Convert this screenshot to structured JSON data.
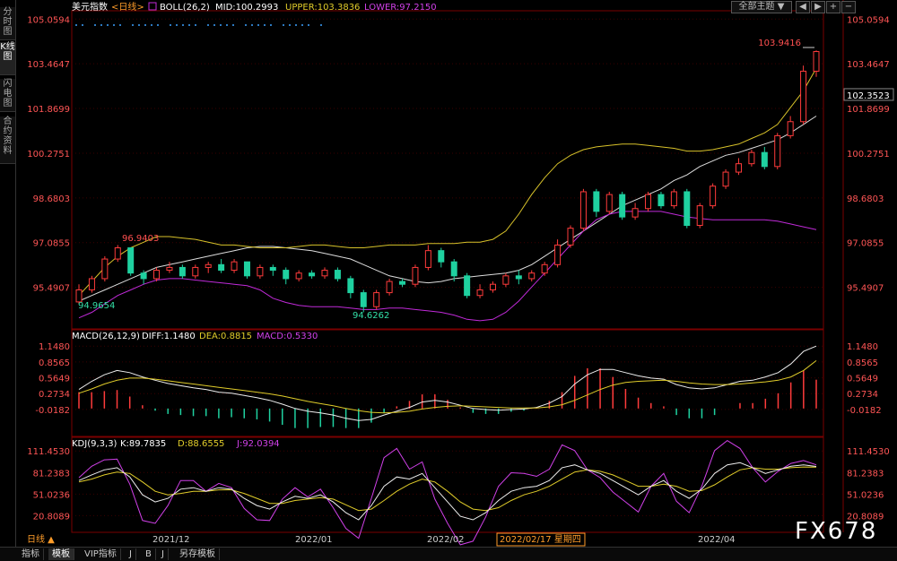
{
  "side_tabs": [
    "分时图",
    "K线图",
    "闪电图",
    "合约资料"
  ],
  "top_controls": {
    "theme": "全部主题",
    "arrow": "▼",
    "btns": [
      "◀",
      "▶",
      "+",
      "−"
    ]
  },
  "bottom_tabs": [
    "指标",
    "模板",
    "VIP指标",
    "J",
    "B",
    "J",
    "另存模板"
  ],
  "period_label": "日线 ▲",
  "watermark": "FX678",
  "colors": {
    "up": "#ff3b3b",
    "down": "#1fd1a0",
    "mid": "#dddddd",
    "upper": "#d8c22a",
    "lower": "#c02ad8",
    "grid": "#3a0000"
  },
  "chart_data": [
    {
      "type": "candlestick",
      "panel": "main",
      "header": {
        "name": "美元指数",
        "period": "<日线>",
        "boll": "BOLL(26,2)",
        "mid": "MID:100.2993",
        "upper": "UPPER:103.3836",
        "lower": "LOWER:97.2150"
      },
      "yticks": [
        "105.0594",
        "103.4647",
        "101.8699",
        "100.2751",
        "98.6803",
        "97.0855",
        "95.4907"
      ],
      "yrange": [
        94.2,
        105.1
      ],
      "current_price": "102.3523",
      "annotations": {
        "high": "103.9416",
        "left_low": "94.9654",
        "left_high": "96.9403",
        "mid_low": "94.6262"
      },
      "mid_points": [
        95.0,
        95.2,
        95.4,
        95.6,
        95.8,
        96.0,
        96.2,
        96.3,
        96.4,
        96.5,
        96.6,
        96.7,
        96.8,
        96.9,
        96.95,
        96.95,
        96.9,
        96.85,
        96.8,
        96.7,
        96.6,
        96.5,
        96.3,
        96.1,
        95.9,
        95.8,
        95.7,
        95.65,
        95.7,
        95.8,
        95.85,
        95.9,
        95.95,
        96.0,
        96.1,
        96.3,
        96.6,
        96.9,
        97.2,
        97.5,
        97.8,
        98.1,
        98.4,
        98.6,
        98.8,
        99.0,
        99.3,
        99.5,
        99.8,
        100.0,
        100.2,
        100.3,
        100.45,
        100.6,
        100.75,
        101.0,
        101.3,
        101.6
      ],
      "upper_points": [
        95.2,
        95.7,
        96.2,
        96.6,
        96.9,
        97.1,
        97.3,
        97.3,
        97.25,
        97.2,
        97.1,
        97.0,
        97.0,
        96.95,
        96.9,
        96.9,
        96.9,
        96.95,
        97.0,
        97.0,
        96.95,
        96.9,
        96.9,
        96.95,
        97.0,
        97.0,
        97.0,
        97.05,
        97.05,
        97.05,
        97.1,
        97.1,
        97.2,
        97.5,
        98.1,
        98.8,
        99.4,
        99.9,
        100.2,
        100.4,
        100.5,
        100.55,
        100.6,
        100.6,
        100.55,
        100.5,
        100.45,
        100.35,
        100.35,
        100.4,
        100.5,
        100.6,
        100.8,
        101.0,
        101.3,
        101.9,
        102.5,
        103.3
      ],
      "lower_points": [
        94.4,
        94.6,
        94.9,
        95.2,
        95.4,
        95.6,
        95.75,
        95.8,
        95.8,
        95.75,
        95.7,
        95.65,
        95.6,
        95.55,
        95.4,
        95.1,
        94.95,
        94.85,
        94.8,
        94.8,
        94.8,
        94.75,
        94.7,
        94.7,
        94.75,
        94.75,
        94.7,
        94.65,
        94.6,
        94.5,
        94.35,
        94.3,
        94.35,
        94.6,
        95.0,
        95.5,
        96.0,
        96.5,
        97.0,
        97.5,
        97.9,
        98.1,
        98.2,
        98.2,
        98.2,
        98.2,
        98.1,
        98.0,
        97.95,
        97.9,
        97.9,
        97.9,
        97.9,
        97.9,
        97.85,
        97.75,
        97.65,
        97.55
      ],
      "candles": [
        [
          94.97,
          95.4,
          95.6,
          94.9
        ],
        [
          95.4,
          95.8,
          95.9,
          95.3
        ],
        [
          95.8,
          96.5,
          96.6,
          95.7
        ],
        [
          96.5,
          96.9,
          97.0,
          96.4
        ],
        [
          96.9,
          96.0,
          96.9,
          95.9
        ],
        [
          96.0,
          95.8,
          96.1,
          95.6
        ],
        [
          95.8,
          96.1,
          96.2,
          95.7
        ],
        [
          96.1,
          96.2,
          96.4,
          96.0
        ],
        [
          96.2,
          95.9,
          96.3,
          95.8
        ],
        [
          95.9,
          96.2,
          96.3,
          95.8
        ],
        [
          96.2,
          96.3,
          96.4,
          96.0
        ],
        [
          96.3,
          96.1,
          96.5,
          96.0
        ],
        [
          96.1,
          96.4,
          96.5,
          96.0
        ],
        [
          96.4,
          95.9,
          96.4,
          95.8
        ],
        [
          95.9,
          96.2,
          96.3,
          95.8
        ],
        [
          96.2,
          96.1,
          96.3,
          95.9
        ],
        [
          96.1,
          95.8,
          96.2,
          95.6
        ],
        [
          95.8,
          96.0,
          96.1,
          95.7
        ],
        [
          96.0,
          95.9,
          96.1,
          95.8
        ],
        [
          95.9,
          96.1,
          96.2,
          95.8
        ],
        [
          96.1,
          95.8,
          96.2,
          95.7
        ],
        [
          95.8,
          95.3,
          95.9,
          95.1
        ],
        [
          95.3,
          94.8,
          95.4,
          94.6
        ],
        [
          94.8,
          95.3,
          95.4,
          94.7
        ],
        [
          95.3,
          95.7,
          95.8,
          95.2
        ],
        [
          95.7,
          95.6,
          95.8,
          95.5
        ],
        [
          95.6,
          96.2,
          96.3,
          95.5
        ],
        [
          96.2,
          96.8,
          97.0,
          96.1
        ],
        [
          96.8,
          96.4,
          96.9,
          96.2
        ],
        [
          96.4,
          95.9,
          96.5,
          95.7
        ],
        [
          95.9,
          95.2,
          96.0,
          95.1
        ],
        [
          95.2,
          95.4,
          95.6,
          95.1
        ],
        [
          95.4,
          95.6,
          95.7,
          95.3
        ],
        [
          95.6,
          95.9,
          96.0,
          95.5
        ],
        [
          95.9,
          95.8,
          96.1,
          95.6
        ],
        [
          95.8,
          96.0,
          96.1,
          95.7
        ],
        [
          96.0,
          96.3,
          96.4,
          95.9
        ],
        [
          96.3,
          97.0,
          97.2,
          96.2
        ],
        [
          97.0,
          97.6,
          97.7,
          96.9
        ],
        [
          97.6,
          98.9,
          99.0,
          97.5
        ],
        [
          98.9,
          98.2,
          99.0,
          98.0
        ],
        [
          98.2,
          98.8,
          98.9,
          98.1
        ],
        [
          98.8,
          98.0,
          98.9,
          97.9
        ],
        [
          98.0,
          98.3,
          98.5,
          97.9
        ],
        [
          98.3,
          98.8,
          98.9,
          98.2
        ],
        [
          98.8,
          98.4,
          98.9,
          98.3
        ],
        [
          98.4,
          98.9,
          99.0,
          98.3
        ],
        [
          98.9,
          97.7,
          99.0,
          97.6
        ],
        [
          97.7,
          98.4,
          98.5,
          97.6
        ],
        [
          98.4,
          99.1,
          99.2,
          98.3
        ],
        [
          99.1,
          99.6,
          99.7,
          99.0
        ],
        [
          99.6,
          99.9,
          100.1,
          99.5
        ],
        [
          99.9,
          100.3,
          100.4,
          99.8
        ],
        [
          100.3,
          99.8,
          100.5,
          99.7
        ],
        [
          99.8,
          100.9,
          101.0,
          99.7
        ],
        [
          100.9,
          101.4,
          101.6,
          100.8
        ],
        [
          101.4,
          103.2,
          103.4,
          101.3
        ],
        [
          103.2,
          103.9,
          103.94,
          103.0
        ]
      ]
    },
    {
      "type": "macd",
      "panel": "macd",
      "header": {
        "name": "MACD(26,12,9)",
        "diff": "DIFF:1.1480",
        "dea": "DEA:0.8815",
        "macd": "MACD:0.5330"
      },
      "yticks": [
        "1.1480",
        "0.8565",
        "0.5649",
        "0.2734",
        "-0.0182"
      ],
      "yrange": [
        -0.25,
        1.25
      ],
      "diff": [
        0.35,
        0.5,
        0.62,
        0.7,
        0.66,
        0.58,
        0.52,
        0.46,
        0.42,
        0.38,
        0.35,
        0.3,
        0.28,
        0.24,
        0.2,
        0.15,
        0.08,
        0.0,
        -0.05,
        -0.08,
        -0.12,
        -0.18,
        -0.22,
        -0.2,
        -0.12,
        -0.05,
        0.02,
        0.12,
        0.15,
        0.12,
        0.06,
        0.0,
        -0.02,
        -0.03,
        -0.02,
        -0.01,
        0.02,
        0.1,
        0.22,
        0.45,
        0.62,
        0.72,
        0.72,
        0.66,
        0.6,
        0.56,
        0.54,
        0.44,
        0.38,
        0.36,
        0.38,
        0.44,
        0.5,
        0.52,
        0.58,
        0.66,
        0.82,
        1.05,
        1.148
      ],
      "dea": [
        0.28,
        0.36,
        0.45,
        0.52,
        0.56,
        0.56,
        0.54,
        0.51,
        0.48,
        0.45,
        0.42,
        0.39,
        0.36,
        0.33,
        0.3,
        0.27,
        0.23,
        0.18,
        0.13,
        0.09,
        0.05,
        0.0,
        -0.04,
        -0.07,
        -0.08,
        -0.07,
        -0.05,
        -0.01,
        0.02,
        0.04,
        0.05,
        0.04,
        0.03,
        0.02,
        0.01,
        0.01,
        0.01,
        0.03,
        0.07,
        0.15,
        0.25,
        0.35,
        0.43,
        0.48,
        0.5,
        0.51,
        0.52,
        0.5,
        0.47,
        0.45,
        0.44,
        0.44,
        0.45,
        0.47,
        0.49,
        0.52,
        0.58,
        0.7,
        0.88
      ],
      "hist": [
        0.3,
        0.3,
        0.32,
        0.34,
        0.22,
        0.06,
        -0.04,
        -0.1,
        -0.12,
        -0.14,
        -0.14,
        -0.18,
        -0.16,
        -0.18,
        -0.2,
        -0.24,
        -0.3,
        -0.36,
        -0.36,
        -0.34,
        -0.34,
        -0.36,
        -0.36,
        -0.26,
        -0.08,
        0.04,
        0.14,
        0.26,
        0.26,
        0.16,
        0.02,
        -0.08,
        -0.1,
        -0.1,
        -0.06,
        -0.04,
        0.02,
        0.14,
        0.3,
        0.6,
        0.74,
        0.74,
        0.58,
        0.36,
        0.2,
        0.1,
        0.04,
        -0.12,
        -0.18,
        -0.18,
        -0.12,
        0.0,
        0.1,
        0.1,
        0.18,
        0.28,
        0.48,
        0.7,
        0.53
      ]
    },
    {
      "type": "kdj",
      "panel": "kdj",
      "header": {
        "name": "KDJ(9,3,3)",
        "k": "K:89.7835",
        "d": "D:88.6555",
        "j": "J:92.0394"
      },
      "yticks": [
        "111.4530",
        "81.2383",
        "51.0236",
        "20.8089"
      ],
      "yrange": [
        5,
        118
      ],
      "k": [
        70,
        78,
        85,
        88,
        75,
        50,
        40,
        45,
        58,
        60,
        55,
        60,
        58,
        45,
        35,
        30,
        40,
        48,
        45,
        50,
        40,
        25,
        15,
        35,
        62,
        75,
        72,
        80,
        60,
        40,
        20,
        15,
        25,
        42,
        55,
        60,
        62,
        70,
        88,
        92,
        85,
        80,
        70,
        60,
        50,
        62,
        70,
        55,
        45,
        58,
        80,
        92,
        95,
        88,
        80,
        85,
        90,
        92,
        89.8
      ],
      "d": [
        68,
        72,
        78,
        82,
        80,
        68,
        55,
        50,
        52,
        55,
        55,
        57,
        57,
        52,
        45,
        38,
        38,
        42,
        44,
        46,
        44,
        36,
        28,
        30,
        42,
        55,
        65,
        72,
        68,
        55,
        40,
        30,
        28,
        32,
        42,
        50,
        55,
        62,
        72,
        82,
        85,
        83,
        78,
        70,
        62,
        62,
        65,
        62,
        55,
        56,
        64,
        75,
        85,
        88,
        86,
        86,
        88,
        89,
        88.7
      ],
      "j": [
        74,
        90,
        99,
        100,
        65,
        14,
        10,
        35,
        70,
        70,
        55,
        66,
        60,
        31,
        15,
        14,
        44,
        60,
        47,
        58,
        32,
        3,
        -11,
        45,
        102,
        115,
        86,
        96,
        44,
        10,
        -20,
        -15,
        19,
        62,
        81,
        80,
        76,
        86,
        120,
        112,
        85,
        74,
        54,
        40,
        26,
        62,
        80,
        41,
        25,
        62,
        112,
        126,
        115,
        88,
        68,
        83,
        94,
        98,
        92
      ]
    }
  ],
  "x_labels": [
    "2021/12",
    "2022/01",
    "2022/02",
    "2022/02/17 星期四",
    "2022/04"
  ]
}
